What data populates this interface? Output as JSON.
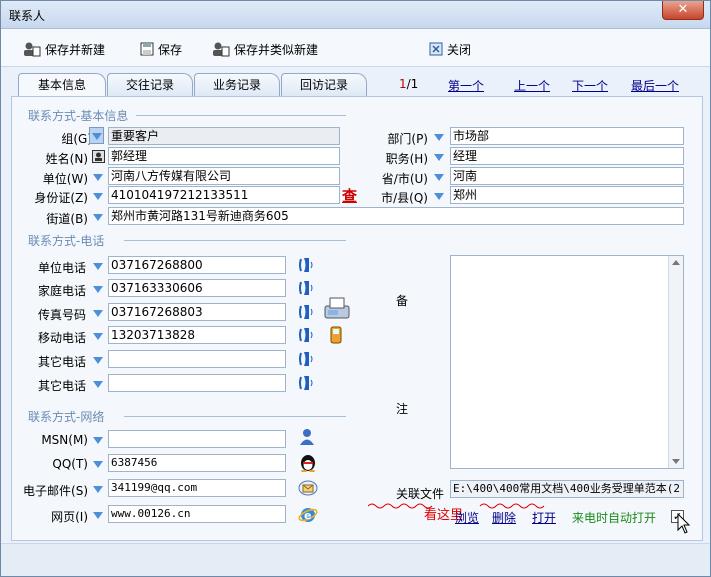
{
  "window": {
    "title": "联系人",
    "close_label": "✕"
  },
  "toolbar": {
    "save_new": "保存并新建",
    "save": "保存",
    "save_similar": "保存并类似新建",
    "close": "关闭"
  },
  "tabs": [
    "基本信息",
    "交往记录",
    "业务记录",
    "回访记录"
  ],
  "pager": {
    "current": "1",
    "total": "/1",
    "first": "第一个",
    "prev": "上一个",
    "next": "下一个",
    "last": "最后一个"
  },
  "basic": {
    "section_title": "联系方式-基本信息",
    "group_label": "组(G)",
    "group_value": "重要客户",
    "name_label": "姓名(N)",
    "name_value": "郭经理",
    "company_label": "单位(W)",
    "company_value": "河南八方传媒有限公司",
    "id_label": "身份证(Z)",
    "id_value": "410104197212133511",
    "id_lookup": "查",
    "street_label": "街道(B)",
    "street_value": "郑州市黄河路131号新迪商务605",
    "dept_label": "部门(P)",
    "dept_value": "市场部",
    "title_label": "职务(H)",
    "title_value": "经理",
    "province_label": "省/市(U)",
    "province_value": "河南",
    "city_label": "市/县(Q)",
    "city_value": "郑州"
  },
  "phone": {
    "section_title": "联系方式-电话",
    "rows": [
      {
        "label": "单位电话",
        "value": "037167268800"
      },
      {
        "label": "家庭电话",
        "value": "037163330606"
      },
      {
        "label": "传真号码",
        "value": "037167268803"
      },
      {
        "label": "移动电话",
        "value": "13203713828"
      },
      {
        "label": "其它电话",
        "value": ""
      },
      {
        "label": "其它电话",
        "value": ""
      }
    ]
  },
  "network": {
    "section_title": "联系方式-网络",
    "rows": [
      {
        "label": "MSN(M)",
        "value": ""
      },
      {
        "label": "QQ(T)",
        "value": "6387456"
      },
      {
        "label": "电子邮件(S)",
        "value": "341199@qq.com"
      },
      {
        "label": "网页(I)",
        "value": "www.00126.cn"
      }
    ]
  },
  "notes": {
    "label_top": "备",
    "label_bottom": "注",
    "value": ""
  },
  "related": {
    "label": "关联文件",
    "value": "E:\\400\\400常用文档\\400业务受理单范本(2",
    "hint": "看这里",
    "browse": "浏览",
    "delete": "删除",
    "open": "打开",
    "auto_open": "来电时自动打开",
    "auto_open_checked": true
  }
}
